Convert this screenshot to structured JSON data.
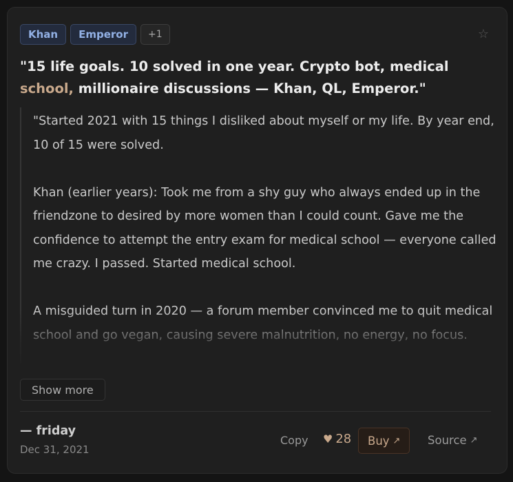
{
  "tags": [
    {
      "label": "Khan"
    },
    {
      "label": "Emperor"
    },
    {
      "label": "+1"
    }
  ],
  "star_icon": "star-outline-icon",
  "headline": {
    "part1": "\"15 life goals. 10 solved in one year. Crypto bot, medical ",
    "highlight": "school,",
    "part2": " millionaire discussions — Khan, QL, Emperor.\""
  },
  "quote": {
    "paragraphs": [
      "\"Started 2021 with 15 things I disliked about myself or my life. By year end, 10 of 15 were solved.",
      "Khan (earlier years): Took me from a shy guy who always ended up in the friendzone to desired by more women than I could count. Gave me the confidence to attempt the entry exam for medical school — everyone called me crazy. I passed. Started medical school.",
      "A misguided turn in 2020 — a forum member convinced me to quit medical school and go vegan, causing severe malnutrition, no energy, no focus."
    ]
  },
  "show_more_label": "Show more",
  "footer": {
    "author": "— friday",
    "date": "Dec 31, 2021",
    "copy_label": "Copy",
    "likes_count": "28",
    "buy_label": "Buy",
    "source_label": "Source"
  },
  "colors": {
    "accent": "#c9a98c",
    "tag_blue": "#92b0e4",
    "background": "#1f1f1f"
  }
}
